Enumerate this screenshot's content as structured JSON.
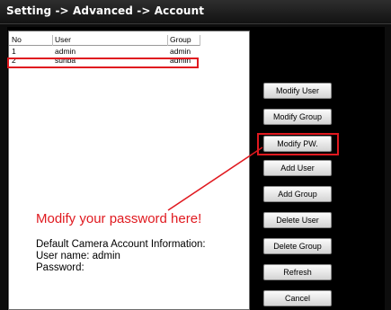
{
  "breadcrumb": "Setting -> Advanced -> Account",
  "table": {
    "headers": [
      "No",
      "User",
      "Group"
    ],
    "rows": [
      {
        "no": "1",
        "user": "admin",
        "group": "admin"
      },
      {
        "no": "2",
        "user": "sunba",
        "group": "admin"
      }
    ]
  },
  "buttons": {
    "modify_user": "Modify User",
    "modify_group": "Modify Group",
    "modify_pw": "Modify PW.",
    "add_user": "Add User",
    "add_group": "Add Group",
    "delete_user": "Delete User",
    "delete_group": "Delete Group",
    "refresh": "Refresh",
    "cancel": "Cancel"
  },
  "annotation": {
    "callout": "Modify your password here!",
    "info_title": "Default Camera Account Information:",
    "username_line": "User name: admin",
    "password_line": "Password:"
  },
  "colors": {
    "annotation_red": "#e0191f",
    "background": "#000000"
  }
}
